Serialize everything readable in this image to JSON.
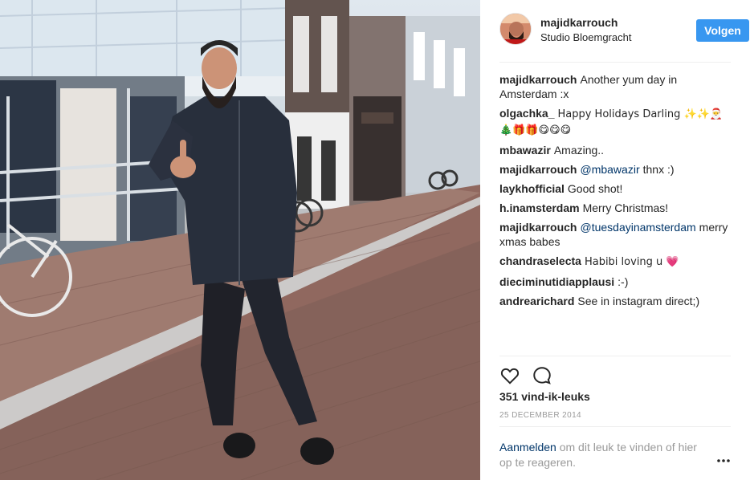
{
  "post": {
    "username": "majidkarrouch",
    "location": "Studio Bloemgracht",
    "follow_label": "Volgen",
    "likes": "351 vind-ik-leuks",
    "date": "25 DECEMBER 2014"
  },
  "comments": [
    {
      "user": "majidkarrouch",
      "text": "Another yum day in Amsterdam :x"
    },
    {
      "user": "olgachka_",
      "text": "Happy Holidays Darling ✨✨🎅 🎄🎁🎁😋😋😋"
    },
    {
      "user": "mbawazir",
      "text": "Amazing.."
    },
    {
      "user": "majidkarrouch",
      "mention": "@mbawazir",
      "text": "thnx :)"
    },
    {
      "user": "laykhofficial",
      "text": "Good shot!"
    },
    {
      "user": "h.inamsterdam",
      "text": "Merry Christmas!"
    },
    {
      "user": "majidkarrouch",
      "mention": "@tuesdayinamsterdam",
      "text": "merry xmas babes"
    },
    {
      "user": "chandraselecta",
      "text": "Habibi loving u 💗"
    },
    {
      "user": "dieciminutidiapplausi",
      "text": ":-)"
    },
    {
      "user": "andrearichard",
      "text": "See in instagram direct;)"
    }
  ],
  "footer": {
    "login_link": "Aanmelden",
    "login_text": "om dit leuk te vinden of hier op te reageren."
  },
  "icons": {
    "like": "heart-icon",
    "comment": "comment-icon",
    "more": "more-options-icon"
  },
  "colors": {
    "follow_button": "#3897f0",
    "mention": "#003569",
    "muted": "#999999"
  }
}
